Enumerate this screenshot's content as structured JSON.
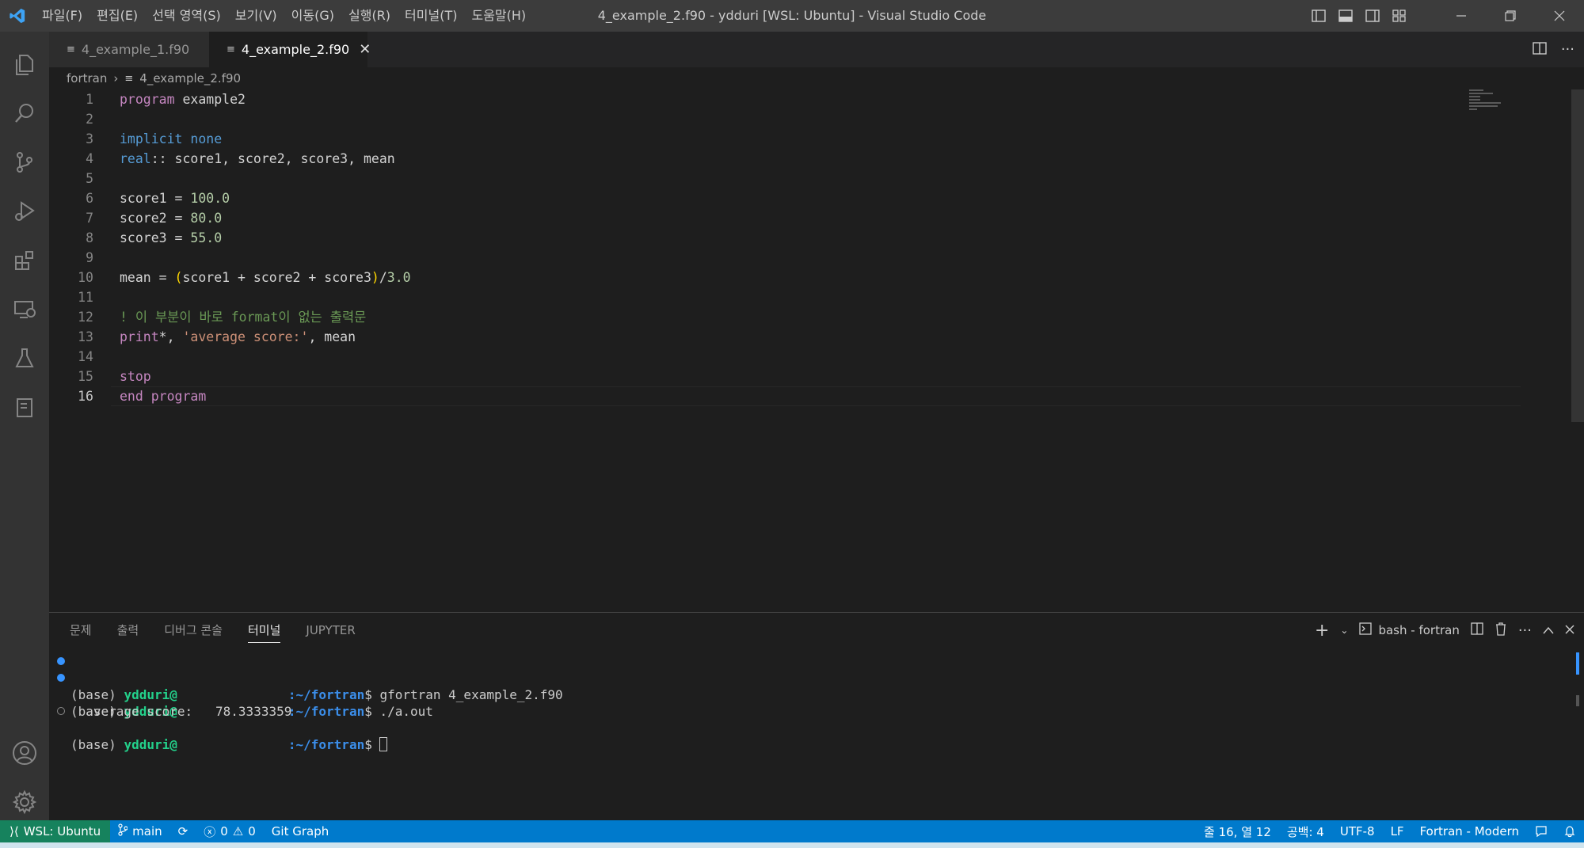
{
  "titlebar": {
    "menu": [
      "파일(F)",
      "편집(E)",
      "선택 영역(S)",
      "보기(V)",
      "이동(G)",
      "실행(R)",
      "터미널(T)",
      "도움말(H)"
    ],
    "title": "4_example_2.f90 - ydduri [WSL: Ubuntu] - Visual Studio Code"
  },
  "tabs": [
    {
      "label": "4_example_1.f90",
      "active": false
    },
    {
      "label": "4_example_2.f90",
      "active": true
    }
  ],
  "breadcrumb": {
    "folder": "fortran",
    "file": "4_example_2.f90"
  },
  "editor": {
    "lines": [
      {
        "n": "1"
      },
      {
        "n": "2"
      },
      {
        "n": "3"
      },
      {
        "n": "4"
      },
      {
        "n": "5"
      },
      {
        "n": "6"
      },
      {
        "n": "7"
      },
      {
        "n": "8"
      },
      {
        "n": "9"
      },
      {
        "n": "10"
      },
      {
        "n": "11"
      },
      {
        "n": "12"
      },
      {
        "n": "13"
      },
      {
        "n": "14"
      },
      {
        "n": "15"
      },
      {
        "n": "16"
      }
    ],
    "tokens": {
      "program": "program",
      "example2": " example2",
      "implicit": "implicit",
      "none": "none",
      "real": "real",
      "decl": ":: score1, score2, score3, mean",
      "s1": "score1 = ",
      "v1": "100.0",
      "s2": "score2 = ",
      "v2": "80.0",
      "s3": "score3 = ",
      "v3": "55.0",
      "mean_eq": "mean = ",
      "lp": "(",
      "sum": "score1 + score2 + score3",
      "rp": ")",
      "div": "/",
      "v4": "3.0",
      "comment": "! 이 부분이 바로 format이 없는 출력문",
      "print": "print",
      "star": "*, ",
      "str": "'average score:'",
      "pmean": ", mean",
      "stop": "stop",
      "end": "end program"
    }
  },
  "panel": {
    "tabs": [
      "문제",
      "출력",
      "디버그 콘솔",
      "터미널",
      "JUPYTER"
    ],
    "active_tab": "터미널",
    "terminal_name": "bash - fortran",
    "terminal": {
      "prefix": "(base) ",
      "user": "ydduri@",
      "path": ":~/fortran",
      "cmd1": "$ gfortran 4_example_2.f90",
      "cmd2": "$ ./a.out",
      "output": "  average score:   78.3333359",
      "cmd3": "$ "
    }
  },
  "statusbar": {
    "remote": "WSL: Ubuntu",
    "branch": "main",
    "errors": "0",
    "warnings": "0",
    "git_graph": "Git Graph",
    "position": "줄 16, 열 12",
    "spaces": "공백: 4",
    "encoding": "UTF-8",
    "eol": "LF",
    "language": "Fortran - Modern"
  },
  "colors": {
    "statusbar": "#007acc",
    "remote": "#16825d",
    "activitybar": "#333333",
    "editor": "#1e1e1e"
  }
}
